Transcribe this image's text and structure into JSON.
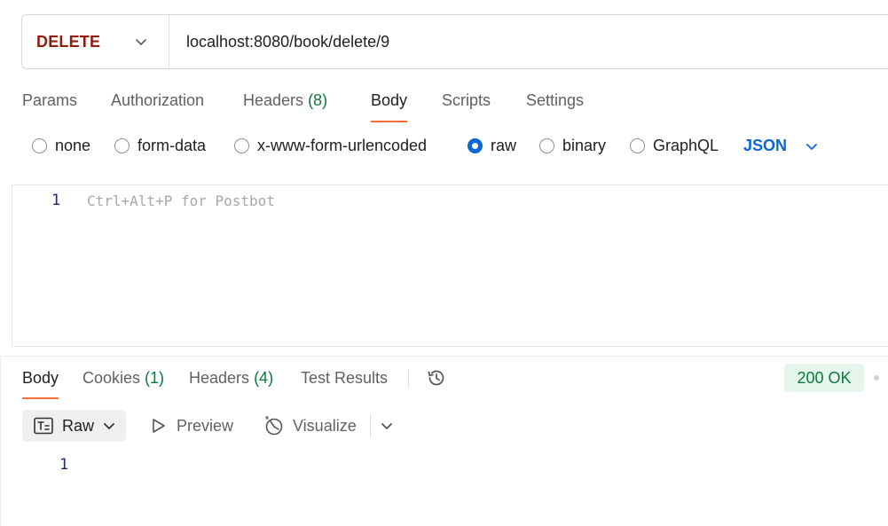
{
  "request": {
    "method": "DELETE",
    "url": "localhost:8080/book/delete/9"
  },
  "request_tabs": [
    {
      "label": "Params"
    },
    {
      "label": "Authorization"
    },
    {
      "label": "Headers",
      "count": "(8)"
    },
    {
      "label": "Body",
      "active": true
    },
    {
      "label": "Scripts"
    },
    {
      "label": "Settings"
    }
  ],
  "body_types": [
    {
      "label": "none",
      "checked": false
    },
    {
      "label": "form-data",
      "checked": false
    },
    {
      "label": "x-www-form-urlencoded",
      "checked": false
    },
    {
      "label": "raw",
      "checked": true
    },
    {
      "label": "binary",
      "checked": false
    },
    {
      "label": "GraphQL",
      "checked": false
    }
  ],
  "body_format": "JSON",
  "editor": {
    "line_number": "1",
    "placeholder": "Ctrl+Alt+P for Postbot"
  },
  "response_tabs": [
    {
      "label": "Body",
      "active": true
    },
    {
      "label": "Cookies",
      "count": "(1)"
    },
    {
      "label": "Headers",
      "count": "(4)"
    },
    {
      "label": "Test Results"
    }
  ],
  "status": "200 OK",
  "response_toolbar": {
    "raw": "Raw",
    "preview": "Preview",
    "visualize": "Visualize"
  },
  "response_body": {
    "line_number": "1"
  },
  "colors": {
    "method": "#8f1d0f",
    "accent_tab": "#ff6c37",
    "radio_checked": "#0b66d6",
    "count_green": "#0a7a3c",
    "status_bg": "#e6f6ec"
  },
  "icons": [
    "chevron-down-icon",
    "history-icon",
    "raw-text-icon",
    "play-icon",
    "visualize-icon"
  ]
}
